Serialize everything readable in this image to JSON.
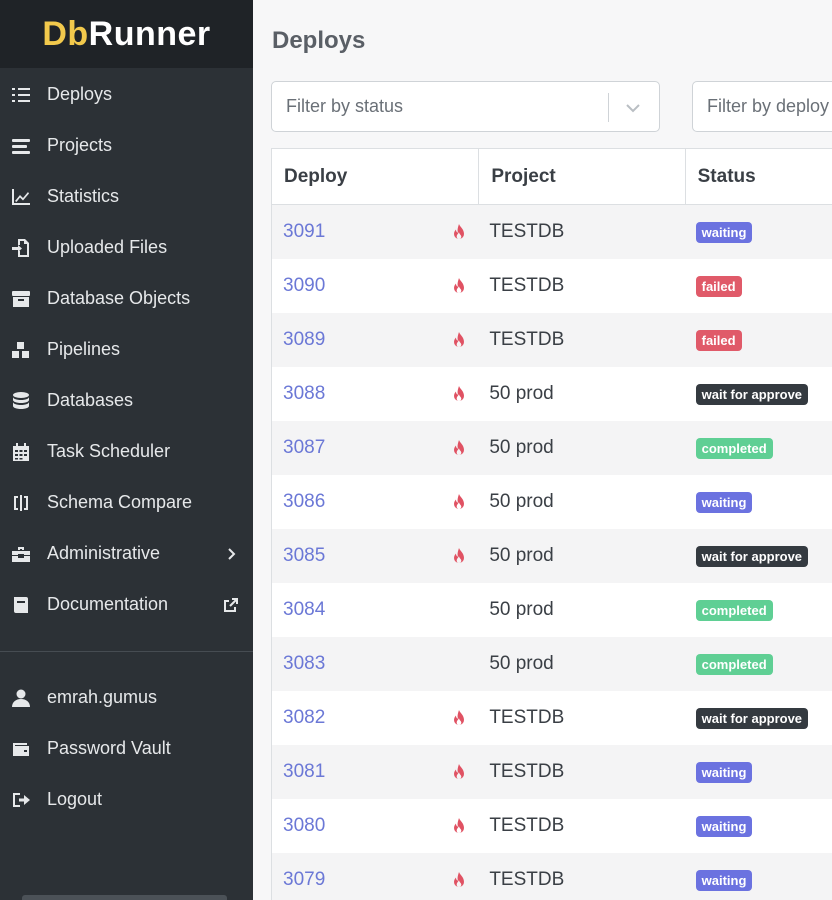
{
  "brand": {
    "part1": "Db",
    "part2": "Runner"
  },
  "sidebar": {
    "main_items": [
      {
        "label": "Deploys",
        "icon": "list-check-icon"
      },
      {
        "label": "Projects",
        "icon": "bars-icon"
      },
      {
        "label": "Statistics",
        "icon": "chart-line-icon"
      },
      {
        "label": "Uploaded Files",
        "icon": "file-import-icon"
      },
      {
        "label": "Database Objects",
        "icon": "archive-icon"
      },
      {
        "label": "Pipelines",
        "icon": "cubes-icon"
      },
      {
        "label": "Databases",
        "icon": "database-icon"
      },
      {
        "label": "Task Scheduler",
        "icon": "calendar-icon"
      },
      {
        "label": "Schema Compare",
        "icon": "columns-icon"
      },
      {
        "label": "Administrative",
        "icon": "toolbox-icon"
      },
      {
        "label": "Documentation",
        "icon": "book-icon"
      }
    ],
    "user_items": [
      {
        "label": "emrah.gumus",
        "icon": "user-icon"
      },
      {
        "label": "Password Vault",
        "icon": "wallet-icon"
      },
      {
        "label": "Logout",
        "icon": "sign-out-icon"
      }
    ]
  },
  "page": {
    "title": "Deploys",
    "filter_status_placeholder": "Filter by status",
    "filter_deploy_placeholder": "Filter by deploy"
  },
  "table": {
    "headers": {
      "deploy": "Deploy",
      "project": "Project",
      "status": "Status"
    },
    "rows": [
      {
        "deploy": "3091",
        "hot": true,
        "project": "TESTDB",
        "status": "waiting"
      },
      {
        "deploy": "3090",
        "hot": true,
        "project": "TESTDB",
        "status": "failed"
      },
      {
        "deploy": "3089",
        "hot": true,
        "project": "TESTDB",
        "status": "failed"
      },
      {
        "deploy": "3088",
        "hot": true,
        "project": "50 prod",
        "status": "wait for approve"
      },
      {
        "deploy": "3087",
        "hot": true,
        "project": "50 prod",
        "status": "completed"
      },
      {
        "deploy": "3086",
        "hot": true,
        "project": "50 prod",
        "status": "waiting"
      },
      {
        "deploy": "3085",
        "hot": true,
        "project": "50 prod",
        "status": "wait for approve"
      },
      {
        "deploy": "3084",
        "hot": false,
        "project": "50 prod",
        "status": "completed"
      },
      {
        "deploy": "3083",
        "hot": false,
        "project": "50 prod",
        "status": "completed"
      },
      {
        "deploy": "3082",
        "hot": true,
        "project": "TESTDB",
        "status": "wait for approve"
      },
      {
        "deploy": "3081",
        "hot": true,
        "project": "TESTDB",
        "status": "waiting"
      },
      {
        "deploy": "3080",
        "hot": true,
        "project": "TESTDB",
        "status": "waiting"
      },
      {
        "deploy": "3079",
        "hot": true,
        "project": "TESTDB",
        "status": "waiting"
      }
    ]
  },
  "status_colors": {
    "waiting": "#6b72e0",
    "failed": "#e05a69",
    "wait for approve": "#343a40",
    "completed": "#5fcf94"
  },
  "colors": {
    "sidebar_bg": "#2c3136",
    "brand_bg": "#1f2327",
    "brand_accent": "#f2c94c",
    "link": "#6b78d6",
    "flame": "#e05263"
  }
}
